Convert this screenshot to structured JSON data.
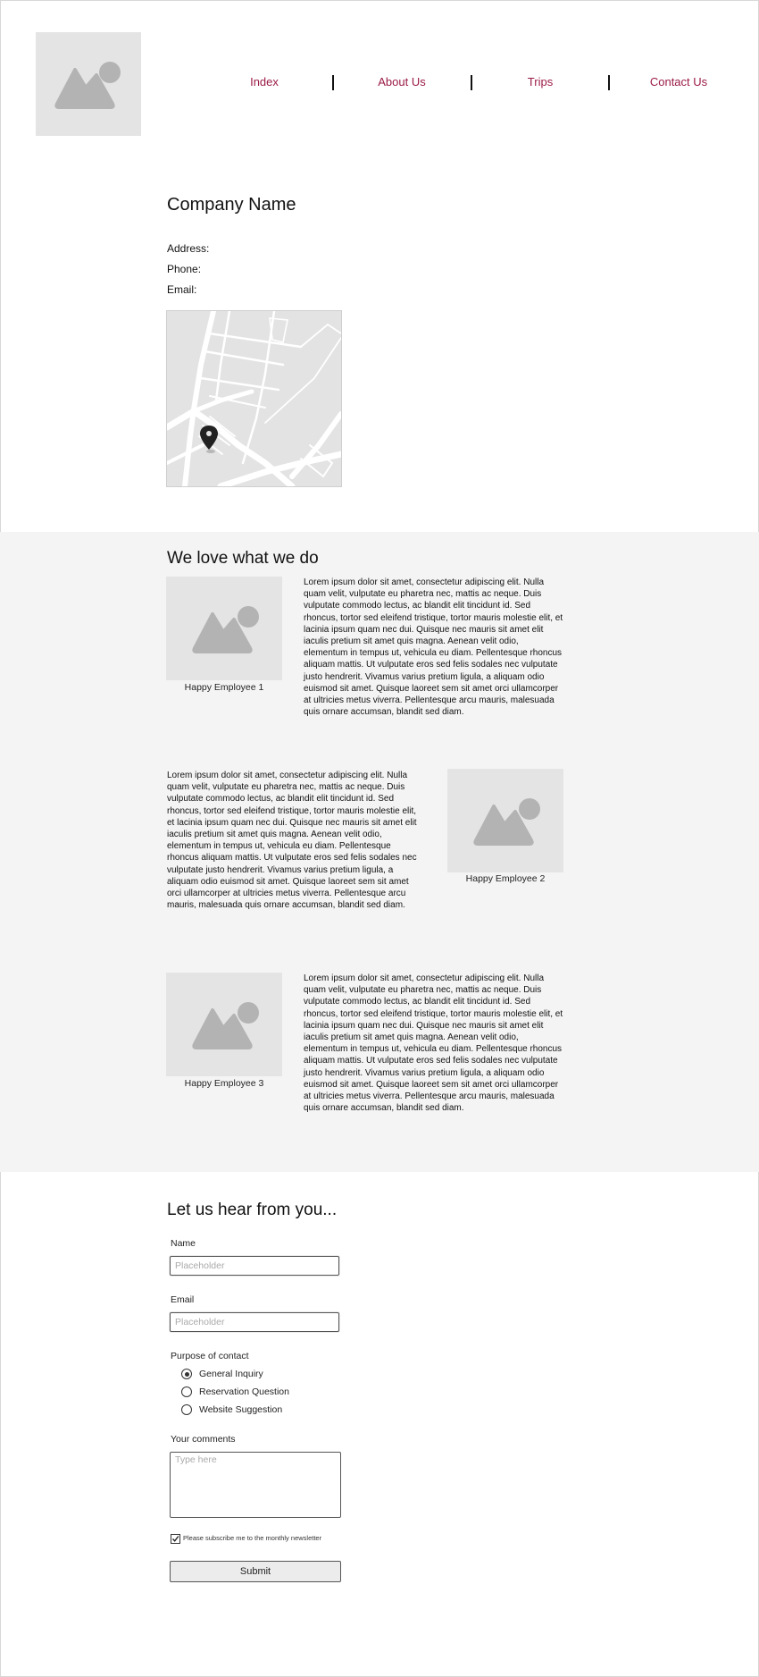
{
  "header": {
    "logo_icon": "image-placeholder-icon",
    "nav": [
      {
        "label": "Index"
      },
      {
        "label": "About Us"
      },
      {
        "label": "Trips"
      },
      {
        "label": "Contact Us"
      }
    ],
    "separator": "|"
  },
  "company": {
    "name": "Company Name",
    "address_label": "Address:",
    "phone_label": "Phone:",
    "email_label": "Email:",
    "map_icon": "map-pin-icon"
  },
  "employees_section": {
    "title": "We love what we do",
    "employees": [
      {
        "caption": "Happy Employee 1",
        "text": "Lorem ipsum dolor sit amet, consectetur adipiscing elit. Nulla quam velit, vulputate eu pharetra nec, mattis ac neque. Duis vulputate commodo lectus, ac blandit elit tincidunt id. Sed rhoncus, tortor sed eleifend tristique, tortor mauris molestie elit, et lacinia ipsum quam nec dui. Quisque nec mauris sit amet elit iaculis pretium sit amet quis magna. Aenean velit odio, elementum in tempus ut, vehicula eu diam. Pellentesque rhoncus aliquam mattis. Ut vulputate eros sed felis sodales nec vulputate justo hendrerit. Vivamus varius pretium ligula, a aliquam odio euismod sit amet. Quisque laoreet sem sit amet orci ullamcorper at ultricies metus viverra. Pellentesque arcu mauris, malesuada quis ornare accumsan, blandit sed diam."
      },
      {
        "caption": "Happy Employee 2",
        "text": "Lorem ipsum dolor sit amet, consectetur adipiscing elit. Nulla quam velit, vulputate eu pharetra nec, mattis ac neque. Duis vulputate commodo lectus, ac blandit elit tincidunt id. Sed rhoncus, tortor sed eleifend tristique, tortor mauris molestie elit, et lacinia ipsum quam nec dui. Quisque nec mauris sit amet elit iaculis pretium sit amet quis magna. Aenean velit odio, elementum in tempus ut, vehicula eu diam. Pellentesque rhoncus aliquam mattis. Ut vulputate eros sed felis sodales nec vulputate justo hendrerit. Vivamus varius pretium ligula, a aliquam odio euismod sit amet. Quisque laoreet sem sit amet orci ullamcorper at ultricies metus viverra. Pellentesque arcu mauris, malesuada quis ornare accumsan, blandit sed diam."
      },
      {
        "caption": "Happy Employee 3",
        "text": "Lorem ipsum dolor sit amet, consectetur adipiscing elit. Nulla quam velit, vulputate eu pharetra nec, mattis ac neque. Duis vulputate commodo lectus, ac blandit elit tincidunt id. Sed rhoncus, tortor sed eleifend tristique, tortor mauris molestie elit, et lacinia ipsum quam nec dui. Quisque nec mauris sit amet elit iaculis pretium sit amet quis magna. Aenean velit odio, elementum in tempus ut, vehicula eu diam. Pellentesque rhoncus aliquam mattis. Ut vulputate eros sed felis sodales nec vulputate justo hendrerit. Vivamus varius pretium ligula, a aliquam odio euismod sit amet. Quisque laoreet sem sit amet orci ullamcorper at ultricies metus viverra. Pellentesque arcu mauris, malesuada quis ornare accumsan, blandit sed diam."
      }
    ]
  },
  "contact_form": {
    "title": "Let us hear from you...",
    "name_label": "Name",
    "name_placeholder": "Placeholder",
    "email_label": "Email",
    "email_placeholder": "Placeholder",
    "purpose_label": "Purpose of contact",
    "options": [
      {
        "label": "General Inquiry",
        "selected": true
      },
      {
        "label": "Reservation Question",
        "selected": false
      },
      {
        "label": "Website Suggestion",
        "selected": false
      }
    ],
    "comments_label": "Your comments",
    "comments_placeholder": "Type here",
    "newsletter_label": "Please subscribe me to the monthly newsletter",
    "newsletter_checked": true,
    "submit_label": "Submit"
  },
  "colors": {
    "nav_link": "#9b1b45",
    "section_bg": "#f4f4f4",
    "placeholder_bg": "#e4e4e4",
    "placeholder_icon": "#b3b3b3"
  }
}
